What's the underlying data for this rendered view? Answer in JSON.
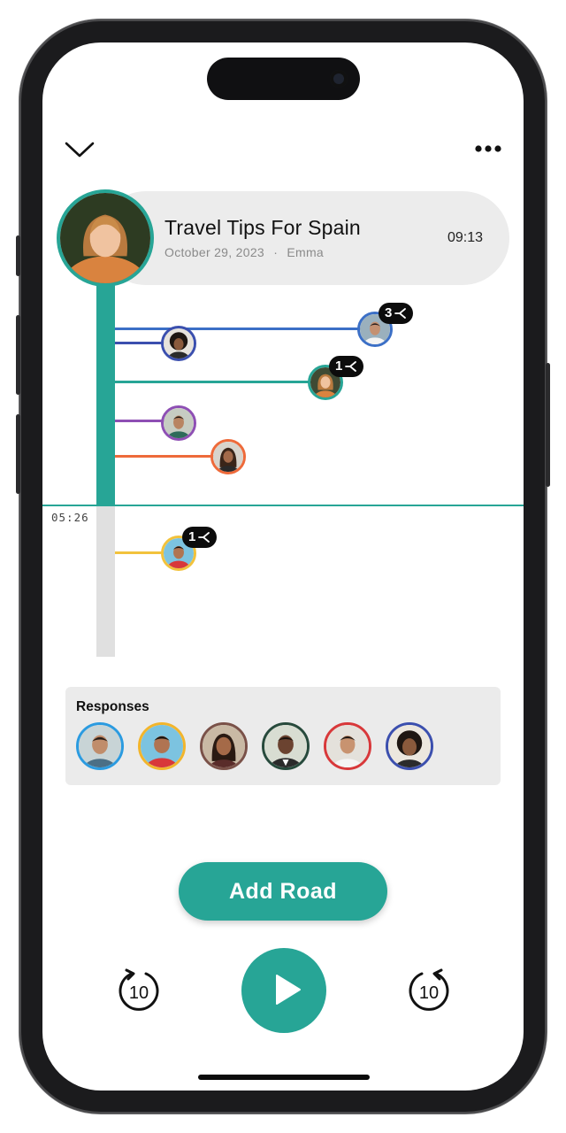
{
  "post": {
    "title": "Travel Tips For Spain",
    "date": "October 29, 2023",
    "separator": "·",
    "author": "Emma",
    "duration": "09:13"
  },
  "timeline": {
    "playhead_time": "05:26",
    "progress_fraction": 0.6,
    "branches": [
      {
        "color": "#3b6fc6",
        "replies": "3"
      },
      {
        "color": "#3b4fae",
        "replies": ""
      },
      {
        "color": "#27a596",
        "replies": "1"
      },
      {
        "color": "#8e4fb4",
        "replies": ""
      },
      {
        "color": "#ee6a3a",
        "replies": ""
      },
      {
        "color": "#f2c23c",
        "replies": "1"
      }
    ]
  },
  "responses": {
    "title": "Responses",
    "avatar_ring_colors": [
      "#2b9be0",
      "#f2b52c",
      "#7a5148",
      "#274a3c",
      "#d8383a",
      "#3b4fae"
    ]
  },
  "actions": {
    "add_road": "Add Road",
    "rewind": "10",
    "forward": "10"
  },
  "icons": {
    "collapse": "chevron-down-icon",
    "more": "more-dots-icon",
    "branch": "branch-icon",
    "play": "play-icon"
  },
  "colors": {
    "accent": "#27a596",
    "pill_bg": "#ececec",
    "panel_bg": "#ebebeb"
  }
}
